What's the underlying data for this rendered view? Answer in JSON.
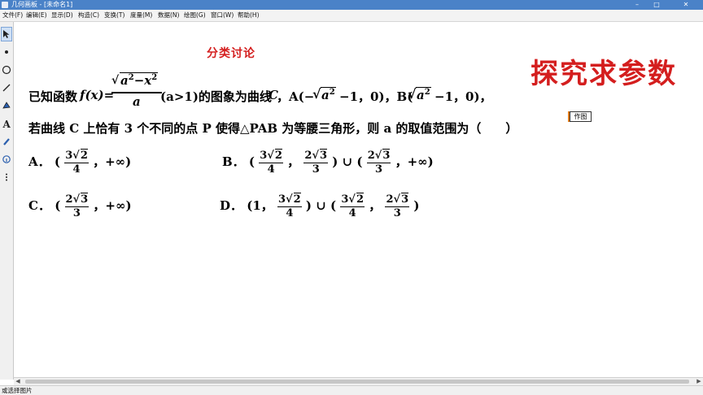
{
  "window": {
    "title": "几何画板 - [未命名1]",
    "controls": [
      "–",
      "□",
      "✕"
    ]
  },
  "menu": [
    "文件(F)",
    "编辑(E)",
    "显示(D)",
    "构造(C)",
    "变换(T)",
    "度量(M)",
    "数据(N)",
    "绘图(G)",
    "窗口(W)",
    "帮助(H)"
  ],
  "toolbar": {
    "tools": [
      "arrow-select-icon",
      "point-icon",
      "compass-icon",
      "straightedge-icon",
      "polygon-icon",
      "text-icon",
      "marker-icon",
      "info-icon",
      "custom-tools-icon"
    ]
  },
  "canvas": {
    "heading": "分类讨论",
    "big_title": "探究求参数",
    "action_button": "作图",
    "problem": {
      "lead": "已知函数",
      "func": "f(x)=",
      "num_a": "a",
      "num_exp": "2",
      "num_minus": "−x",
      "num_exp2": "2",
      "den": "a",
      "cond": "(a>1)的图象为曲线",
      "curve": "C",
      "pointA_pre": "，A(−",
      "pointA_rad": "a",
      "pointA_exp": "2",
      "pointA_post": "−1，0)，B(",
      "pointB_rad": "a",
      "pointB_exp": "2",
      "pointB_post": "−1，0)，",
      "line2": "若曲线 C 上恰有 3 个不同的点 P 使得△PAB 为等腰三角形，则 a 的取值范围为（　　）"
    },
    "options": {
      "A": {
        "label": "A．",
        "open": "(",
        "f1_num_coef": "3",
        "f1_num_rad": "2",
        "f1_den": "4",
        "tail": "，+∞)"
      },
      "B": {
        "label": "B．",
        "open": "(",
        "f1_num_coef": "3",
        "f1_num_rad": "2",
        "f1_den": "4",
        "sep": "，",
        "f2_num_coef": "2",
        "f2_num_rad": "3",
        "f2_den": "3",
        "tail": ") ∪ (",
        "f3_num_coef": "2",
        "f3_num_rad": "3",
        "f3_den": "3",
        "tail2": "，+∞)"
      },
      "C": {
        "label": "C．",
        "open": "(",
        "f1_num_coef": "2",
        "f1_num_rad": "3",
        "f1_den": "3",
        "tail": "，+∞)"
      },
      "D": {
        "label": "D．",
        "open": "(1，",
        "f1_num_coef": "3",
        "f1_num_rad": "2",
        "f1_den": "4",
        "tail": ") ∪ (",
        "f2_num_coef": "3",
        "f2_num_rad": "2",
        "f2_den": "4",
        "sep": "，",
        "f3_num_coef": "2",
        "f3_num_rad": "3",
        "f3_den": "3",
        "tail2": ")"
      }
    }
  },
  "statusbar": {
    "text": "或选择图片"
  }
}
